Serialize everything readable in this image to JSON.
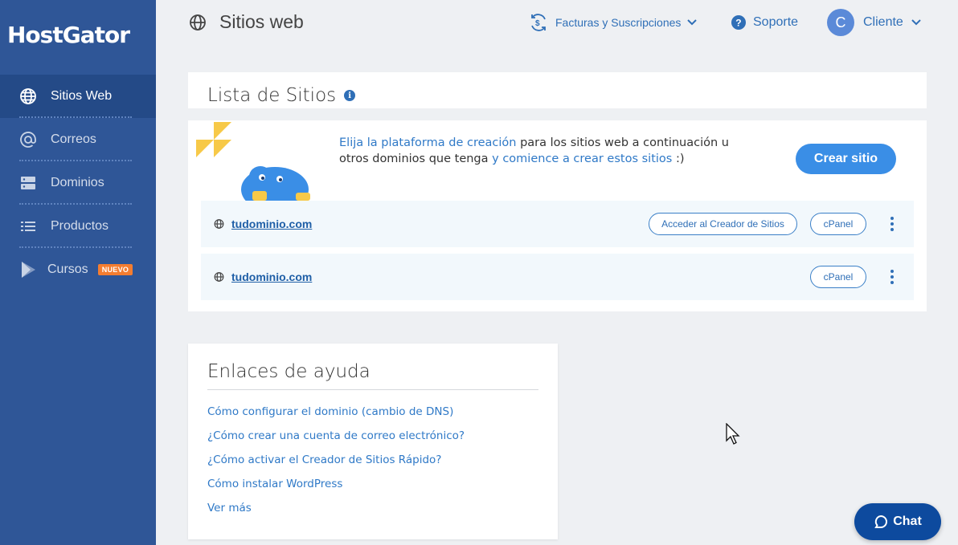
{
  "sidebar": {
    "brand": "HostGator",
    "items": [
      {
        "label": "Sitios Web",
        "icon": "globe-icon"
      },
      {
        "label": "Correos",
        "icon": "at-icon"
      },
      {
        "label": "Dominios",
        "icon": "server-icon"
      },
      {
        "label": "Productos",
        "icon": "list-icon"
      },
      {
        "label": "Cursos",
        "icon": "play-icon",
        "badge": "NUEVO"
      }
    ]
  },
  "header": {
    "title": "Sitios web",
    "billing": "Facturas y Suscripciones",
    "support": "Soporte",
    "user_initial": "C",
    "user_name": "Cliente"
  },
  "sites": {
    "title": "Lista de Sitios",
    "info": "i",
    "promo": {
      "hl1": "Elija la plataforma de creación",
      "t1": " para los sitios web a continuación u otros dominios que tenga ",
      "hl2": "y comience a crear estos sitios",
      "t2": " :)"
    },
    "create_button": "Crear sitio",
    "rows": [
      {
        "domain": "tudominio.com",
        "builder": "Acceder al Creador de Sitios",
        "cpanel": "cPanel"
      },
      {
        "domain": "tudominio.com",
        "cpanel": "cPanel"
      }
    ]
  },
  "help": {
    "title": "Enlaces de ayuda",
    "links": [
      "Cómo configurar el dominio (cambio de DNS)",
      "¿Cómo crear una cuenta de correo electrónico?",
      "¿Cómo activar el Creador de Sitios Rápido?",
      "Cómo instalar WordPress",
      "Ver más"
    ]
  },
  "chat": {
    "label": "Chat"
  },
  "colors": {
    "sidebar": "#2f5697",
    "accent": "#3a8ee6",
    "badge": "#f47d30",
    "chat": "#0d4a9e"
  }
}
